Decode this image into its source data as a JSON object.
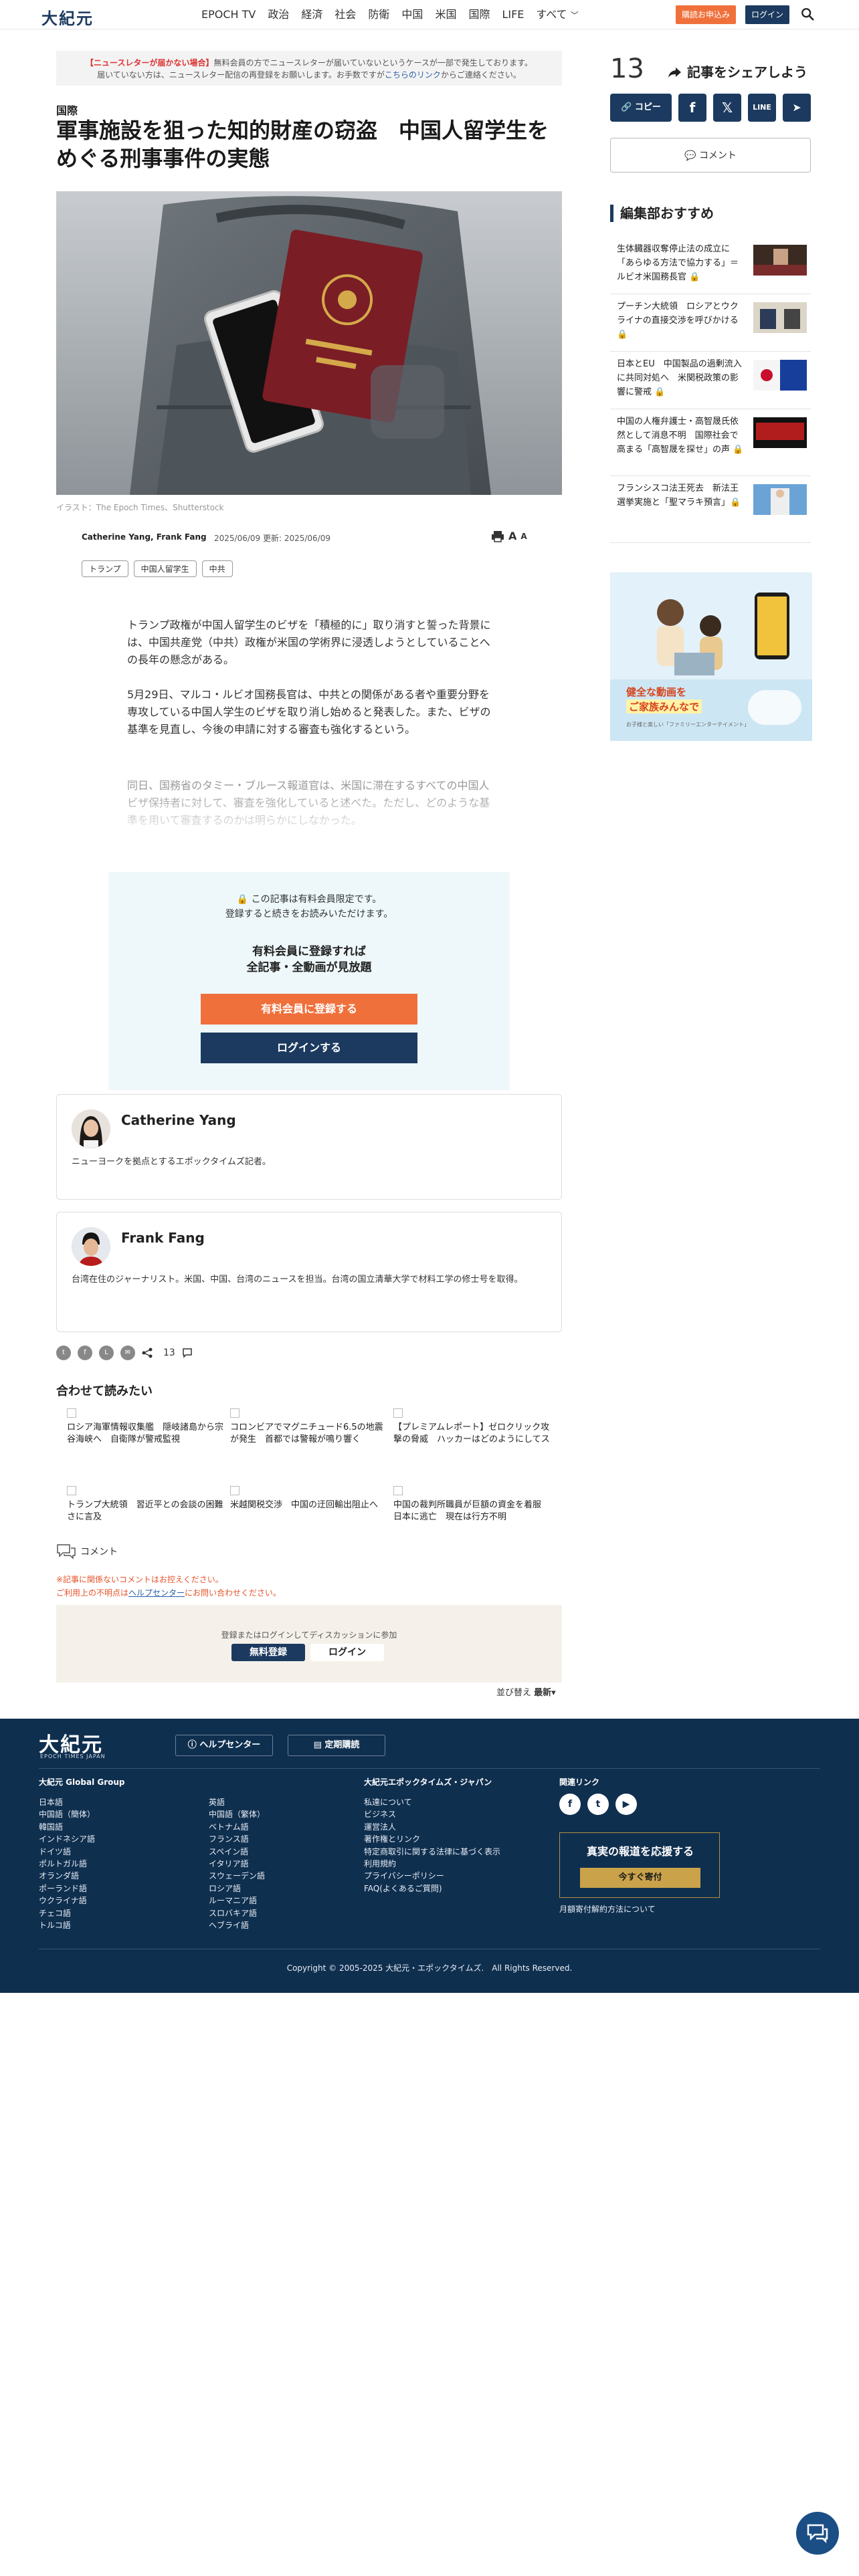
{
  "header": {
    "logo": "大紀元",
    "nav": [
      "EPOCH TV",
      "政治",
      "経済",
      "社会",
      "防衛",
      "中国",
      "米国",
      "国際",
      "LIFE",
      "すべて"
    ],
    "subscribe_label": "購読お申込み",
    "login_label": "ログイン"
  },
  "notice": {
    "red_label": "【ニュースレターが届かない場合】",
    "line1": "無料会員の方でニュースレターが届いていないというケースが一部で発生しております。",
    "line2a": "届いていない方は、ニュースレター配信の再登録をお願いします。お手数ですが",
    "link": "こちらのリンク",
    "line2b": "からご連絡ください。"
  },
  "article": {
    "category": "国際",
    "title": "軍事施設を狙った知的財産の窃盗　中国人留学生をめぐる刑事事件の実態",
    "image_caption": "イラスト：The Epoch Times、Shutterstock",
    "byline": "Catherine Yang, Frank Fang",
    "dates": "2025/06/09 更新: 2025/06/09",
    "tags": [
      "トランプ",
      "中国人留学生",
      "中共"
    ],
    "p1": "トランプ政権が中国人留学生のビザを「積極的に」取り消すと誓った背景には、中国共産党（中共）政権が米国の学術界に浸透しようとしていることへの長年の懸念がある。",
    "p2": "5月29日、マルコ・ルビオ国務長官は、中共との関係がある者や重要分野を専攻している中国人学生のビザを取り消し始めると発表した。また、ビザの基準を見直し、今後の申請に対する審査も強化するという。",
    "p3": "同日、国務省のタミー・ブルース報道官は、米国に滞在するすべての中国人ビザ保持者に対して、審査を強化していると述べた。ただし、どのような基準を用いて審査するのかは明らかにしなかった。"
  },
  "paywall": {
    "line1": "🔒 この記事は有料会員限定です。",
    "line2": "登録すると続きをお読みいただけます。",
    "line3": "有料会員に登録すれば",
    "line4": "全記事・全動画が見放題",
    "register_label": "有料会員に登録する",
    "login_label": "ログインする"
  },
  "authors": [
    {
      "name": "Catherine Yang",
      "desc": "ニューヨークを拠点とするエポックタイムズ記者。"
    },
    {
      "name": "Frank Fang",
      "desc": "台湾在住のジャーナリスト。米国、中国、台湾のニュースを担当。台湾の国立清華大学で材料工学の修士号を取得。"
    }
  ],
  "share_row": {
    "count": "13"
  },
  "recommendations": {
    "title": "合わせて読みたい",
    "items": [
      "ロシア海軍情報収集艦　隠岐諸島から宗谷海峡へ　自衛隊が警戒監視",
      "コロンビアでマグニチュード6.5の地震が発生　首都では警報が鳴り響く",
      "【プレミアムレポート】ゼロクリック攻撃の脅威　ハッカーはどのようにしてスマートフォンを制御できるのか",
      "トランプ大統領　習近平との会談の困難さに言及",
      "米越関税交渉　中国の迂回輸出阻止へ",
      "中国の裁判所職員が巨額の資金を着服　日本に逃亡　現在は行方不明"
    ]
  },
  "comments": {
    "label": "コメント",
    "warn1": "※記事に関係ないコメントはお控えください。",
    "warn2a": "ご利用上の不明点は",
    "warn2_link": "ヘルプセンター",
    "warn2b": "にお問い合わせください。",
    "join_text": "登録またはログインしてディスカッションに参加",
    "free_register": "無料登録",
    "login": "ログイン",
    "sort_label": "並び替え",
    "sort_value": "最新"
  },
  "sidebar": {
    "share_count": "13",
    "share_label": "記事をシェアしよう",
    "copy_label": "コピー",
    "line_label": "LINE",
    "comment_label": "コメント",
    "editor_title": "編集部おすすめ",
    "items": [
      {
        "text": "生体臓器収奪停止法の成立に「あらゆる方法で協力する」＝ルビオ米国務長官 🔒"
      },
      {
        "text": "プーチン大統領　ロシアとウクライナの直接交渉を呼びかける 🔒"
      },
      {
        "text": "日本とEU　中国製品の過剰流入に共同対処へ　米関税政策の影響に警戒 🔒"
      },
      {
        "text": "中国の人権弁護士・高智晟氏依然として消息不明　国際社会で高まる「高智晟を探せ」の声 🔒"
      },
      {
        "text": "フランシスコ法王死去　新法王選挙実施と「聖マラキ預言」🔒"
      }
    ],
    "ad": {
      "title_line1": "健全な動画を",
      "title_line2": "ご家族みんなで",
      "sub": "お子様と楽しい「ファミリーエンターテイメント」"
    }
  },
  "footer": {
    "logo": "大紀元",
    "logo_sub": "EPOCH TIMES JAPAN",
    "help_label": "ヘルプセンター",
    "sub_label": "定期購読",
    "col1_title": "大紀元 Global Group",
    "col1a": [
      "日本語",
      "中国語（簡体）",
      "韓国語",
      "インドネシア語",
      "ドイツ語",
      "ポルトガル語",
      "オランダ語",
      "ポーランド語",
      "ウクライナ語",
      "チェコ語",
      "トルコ語"
    ],
    "col1b": [
      "英語",
      "中国語（繁体）",
      "ベトナム語",
      "フランス語",
      "スペイン語",
      "イタリア語",
      "スウェーデン語",
      "ロシア語",
      "ルーマニア語",
      "スロバキア語",
      "ヘブライ語"
    ],
    "col2_title": "大紀元エポックタイムズ・ジャパン",
    "col2": [
      "私達について",
      "ビジネス",
      "運営法人",
      "著作権とリンク",
      "特定商取引に関する法律に基づく表示",
      "利用規約",
      "プライバシーポリシー",
      "FAQ(よくあるご質問)"
    ],
    "col3_title": "関連リンク",
    "support_title": "真実の報道を応援する",
    "support_button": "今すぐ寄付",
    "monthly": "月額寄付解約方法について",
    "copyright": "Copyright © 2005-2025 大紀元・エポックタイムズ.　All Rights Reserved."
  }
}
